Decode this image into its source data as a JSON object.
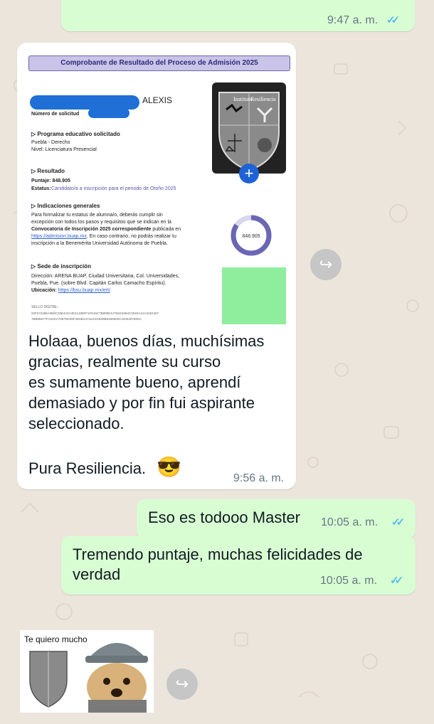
{
  "top_message": {
    "time": "9:47 a. m.",
    "ticks": "✓✓"
  },
  "incoming_photo": {
    "doc": {
      "header": "Comprobante de Resultado del Proceso de Admisión 2025",
      "name_suffix": "ALEXIS",
      "request_label": "Número de solicitud",
      "program_title": "Programa educativo solicitado",
      "program_line1": "Puebla - Derecho",
      "program_line2": "Nivel: Licenciatura Presencial",
      "result_title": "Resultado",
      "score_label": "Puntaje: 848.905",
      "status_label": "Estatus:",
      "status_value": "Candidato/a a inscripción para el periodo de Otoño 2025",
      "general_title": "Indicaciones generales",
      "general_line1": "Para formalizar tu estatus de alumna/o, deberás cumplir sin",
      "general_line2": "excepción con todos los pasos y requisitos que se indican en la",
      "general_line3_a": "Convocatoria de Inscripción 2025 correspondiente",
      "general_line3_b": " publicada en",
      "general_link": "https://admision.buap.mx",
      "general_line4_b": ". En caso contrario, no podrás realizar tu",
      "general_line5": "inscripción a la Benemérita Universidad Autónoma de Puebla.",
      "score_ring": "848.905",
      "site_title": "Sede de inscripción",
      "site_line1": "Dirección: ARENA BUAP, Ciudad Universitaria, Col. Universidades,",
      "site_line2": "Puebla, Pue. (sobre Blvd. Capitán Carlos Camacho Espíritu).",
      "location_label": "Ubicación:",
      "location_link": "https://bsu.buap.mx/ert/",
      "seal_label": "SELLO DIGITAL:",
      "seal_line1": "92F072486A9B8C20E423A3E21489FF1F615C7B890E44755D4984C354EA12A2284487",
      "seal_line2": "7BB85577FA61DA78E7B039F3D6B1AC6418AB49B6468900C3345387B35A",
      "shield_word1": "Instituto",
      "shield_word2": "Resiliencia"
    },
    "message_line1": "Holaaa, buenos días, muchísimas",
    "message_line2": "gracias, realmente su curso",
    "message_line3": "es sumamente bueno, aprendí",
    "message_line4": "demasiado y por fin fui aspirante",
    "message_line5": "seleccionado.",
    "message_line6": "Pura Resiliencia.",
    "emoji": "😎",
    "time": "9:56 a. m."
  },
  "out_message_1": {
    "text": "Eso es todooo Master",
    "time": "10:05 a. m.",
    "ticks": "✓✓"
  },
  "out_message_2": {
    "line1": "Tremendo puntaje, muchas felicidades de",
    "line2": "verdad",
    "time": "10:05 a. m.",
    "ticks": "✓✓"
  },
  "sticker": {
    "caption": "Te quiero mucho"
  },
  "colors": {
    "out_bubble": "#d9fdd3",
    "in_bubble": "#ffffff",
    "ticks": "#53bdeb",
    "background": "#ece5dc"
  }
}
